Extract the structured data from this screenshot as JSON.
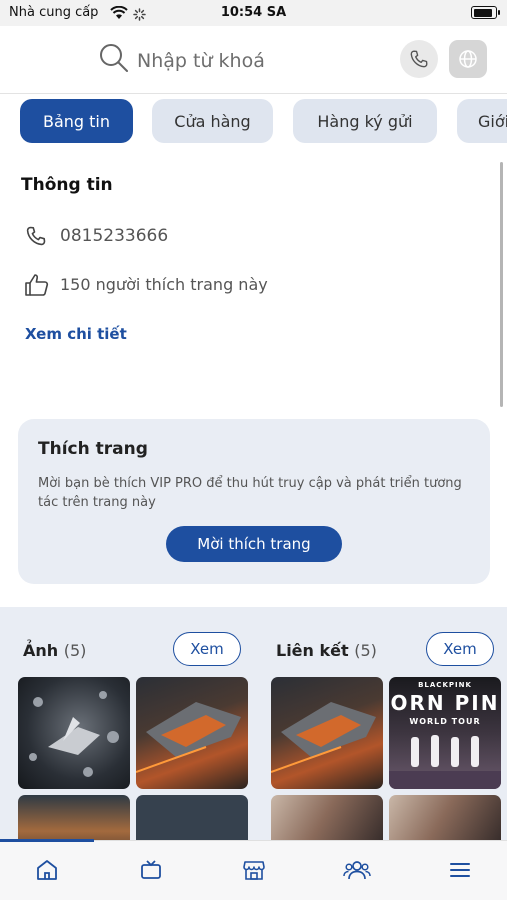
{
  "status_bar": {
    "carrier": "Nhà cung cấp",
    "time": "10:54 SA"
  },
  "search": {
    "placeholder": "Nhập từ khoá"
  },
  "tabs": [
    {
      "label": "Bảng tin",
      "active": true
    },
    {
      "label": "Cửa hàng",
      "active": false
    },
    {
      "label": "Hàng ký gửi",
      "active": false
    },
    {
      "label": "Giới",
      "active": false
    }
  ],
  "info": {
    "title": "Thông tin",
    "phone": "0815233666",
    "likes_text": "150 người thích trang này",
    "detail_link": "Xem chi tiết"
  },
  "like_card": {
    "title": "Thích trang",
    "description": "Mời bạn bè thích VIP PRO để thu hút truy cập và phát triển tương tác trên trang này",
    "button": "Mời thích trang"
  },
  "gallery": {
    "photos": {
      "label": "Ảnh",
      "count": "(5)",
      "view_button": "Xem"
    },
    "links": {
      "label": "Liên kết",
      "count": "(5)",
      "view_button": "Xem"
    },
    "concert_brand": "BLACKPINK",
    "concert_title": "ORN PIN",
    "concert_subtitle": "WORLD TOUR"
  },
  "bottom_nav": {
    "items": [
      "home-icon",
      "tv-icon",
      "store-icon",
      "users-icon",
      "menu-icon"
    ],
    "accent": "#1e4fa0"
  },
  "colors": {
    "primary": "#1e4fa0",
    "tab_inactive": "#dfe5ef",
    "card_bg": "#e9edf4"
  }
}
